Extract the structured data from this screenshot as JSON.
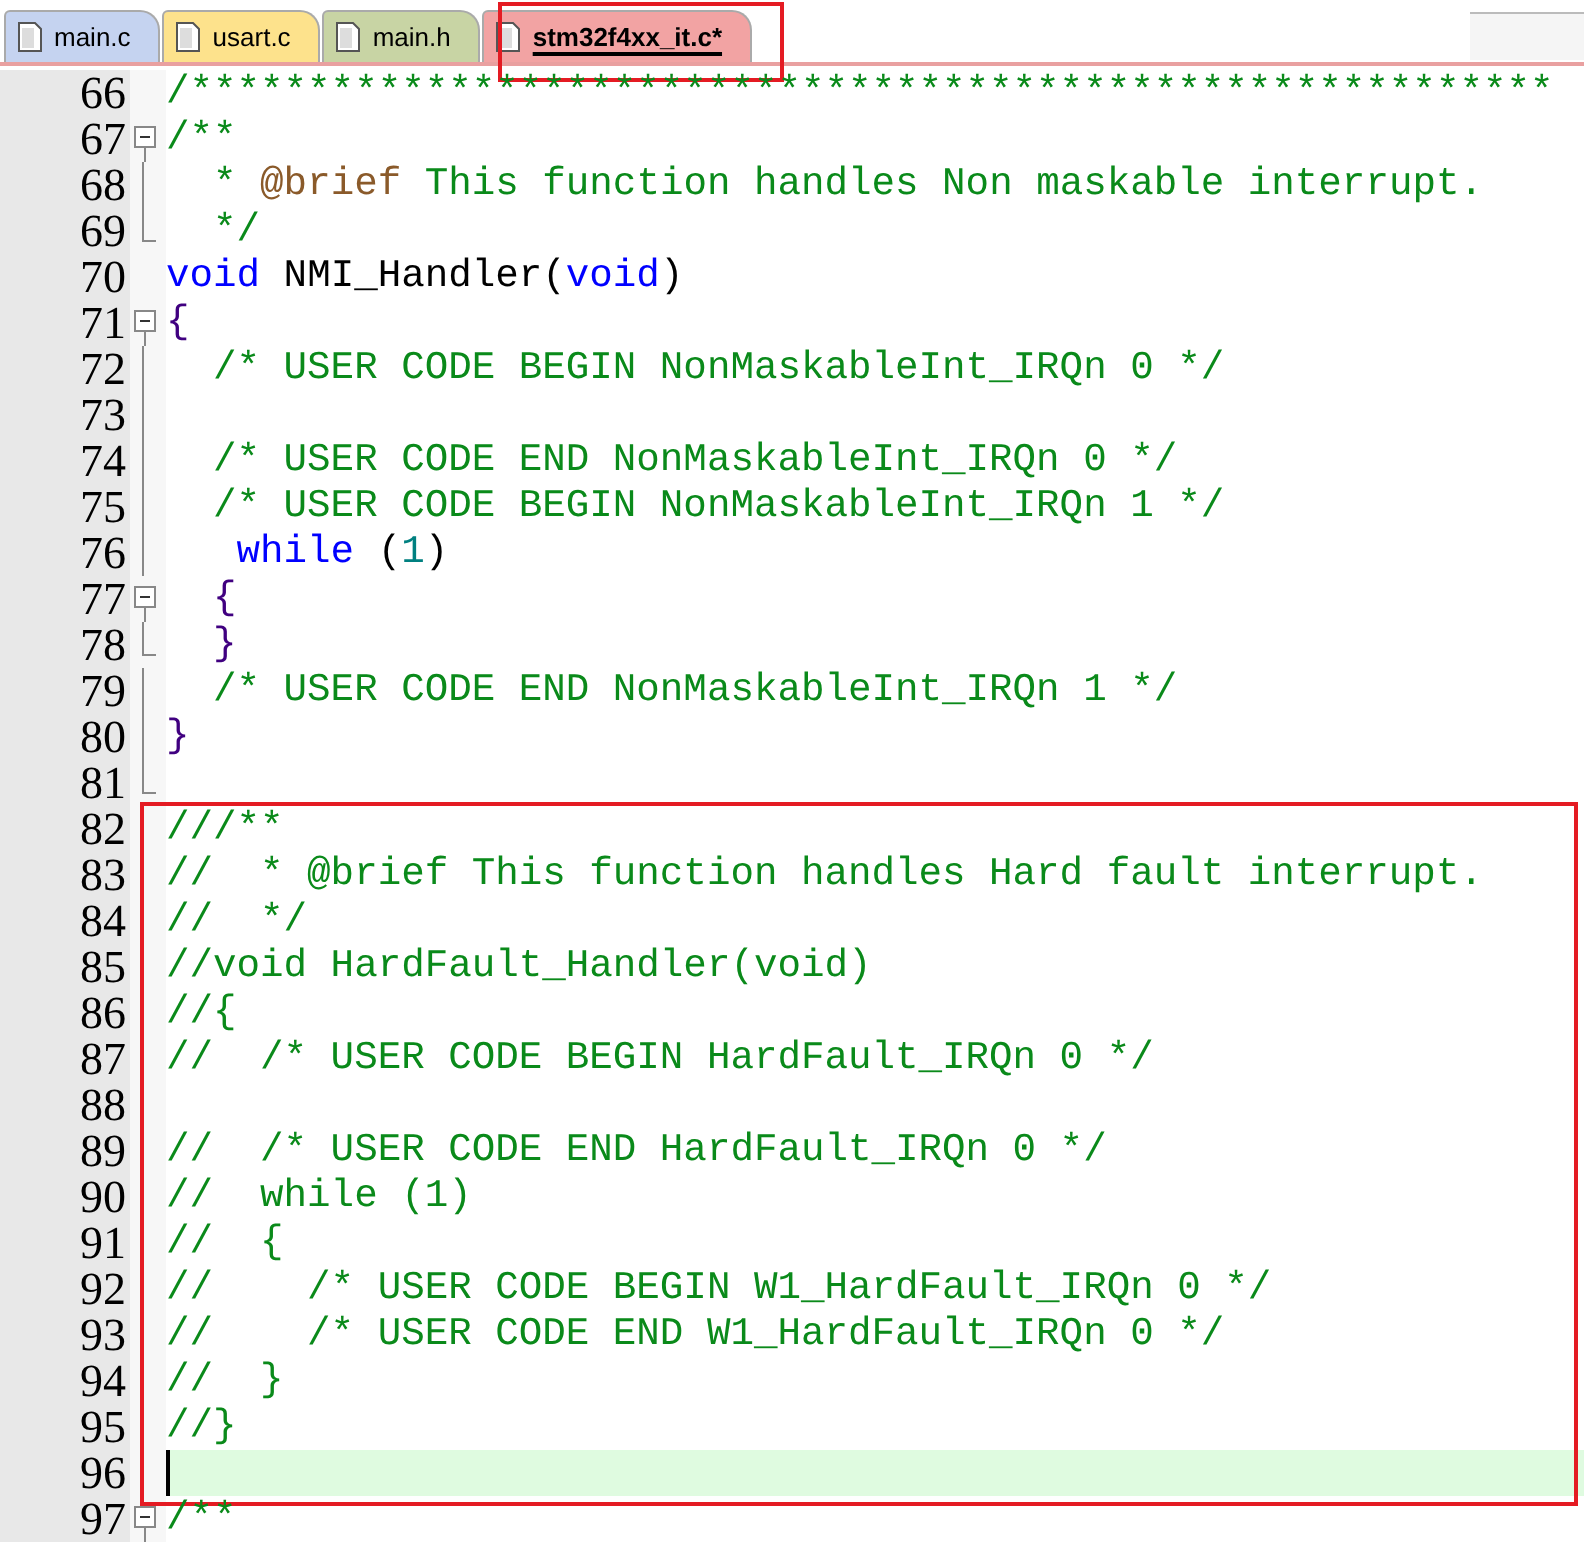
{
  "tabs": [
    {
      "label": "main.c",
      "color": "#c5d3f0",
      "selected": false,
      "highlighted": false
    },
    {
      "label": "usart.c",
      "color": "#fde28c",
      "selected": false,
      "highlighted": false
    },
    {
      "label": "main.h",
      "color": "#c8d4a4",
      "selected": false,
      "highlighted": false
    },
    {
      "label": "stm32f4xx_it.c*",
      "color": "#f2a3a3",
      "selected": true,
      "highlighted": true
    }
  ],
  "blocks": [
    {
      "boxed": false,
      "lines": [
        {
          "number": "66",
          "kind": "plain",
          "current": false,
          "segments": [
            {
              "kind": "comment",
              "text": "/**********************************************************"
            }
          ]
        },
        {
          "number": "67",
          "kind": "foldstart",
          "current": false,
          "segments": [
            {
              "kind": "comment",
              "text": "/**"
            }
          ]
        },
        {
          "number": "68",
          "kind": "foldbody",
          "current": false,
          "segments": [
            {
              "kind": "comment",
              "text": "  * "
            },
            {
              "kind": "doc",
              "text": "@brief"
            },
            {
              "kind": "comment",
              "text": " This function handles Non maskable interrupt."
            }
          ]
        },
        {
          "number": "69",
          "kind": "foldend",
          "current": false,
          "segments": [
            {
              "kind": "comment",
              "text": "  */"
            }
          ]
        },
        {
          "number": "70",
          "kind": "plain",
          "current": false,
          "segments": [
            {
              "kind": "keyword",
              "text": "void"
            },
            {
              "kind": "plain",
              "text": " NMI_Handler("
            },
            {
              "kind": "keyword",
              "text": "void"
            },
            {
              "kind": "plain",
              "text": ")"
            }
          ]
        },
        {
          "number": "71",
          "kind": "foldstart",
          "current": false,
          "segments": [
            {
              "kind": "brace",
              "text": "{"
            }
          ]
        },
        {
          "number": "72",
          "kind": "foldbody",
          "current": false,
          "segments": [
            {
              "kind": "comment",
              "text": "  /* USER CODE BEGIN NonMaskableInt_IRQn 0 */"
            }
          ]
        },
        {
          "number": "73",
          "kind": "foldbody",
          "current": false
        },
        {
          "number": "74",
          "kind": "foldbody",
          "current": false,
          "segments": [
            {
              "kind": "comment",
              "text": "  /* USER CODE END NonMaskableInt_IRQn 0 */"
            }
          ]
        },
        {
          "number": "75",
          "kind": "foldbody",
          "current": false,
          "segments": [
            {
              "kind": "comment",
              "text": "  /* USER CODE BEGIN NonMaskableInt_IRQn 1 */"
            }
          ]
        },
        {
          "number": "76",
          "kind": "foldbody",
          "current": false,
          "segments": [
            {
              "kind": "keyword",
              "text": "   while"
            },
            {
              "kind": "plain",
              "text": " ("
            },
            {
              "kind": "number",
              "text": "1"
            },
            {
              "kind": "plain",
              "text": ")"
            }
          ]
        },
        {
          "number": "77",
          "kind": "foldstart",
          "current": false,
          "segments": [
            {
              "kind": "brace",
              "text": "  {"
            }
          ]
        },
        {
          "number": "78",
          "kind": "foldend",
          "current": false,
          "segments": [
            {
              "kind": "brace",
              "text": "  }"
            }
          ]
        },
        {
          "number": "79",
          "kind": "foldbody",
          "current": false,
          "segments": [
            {
              "kind": "comment",
              "text": "  /* USER CODE END NonMaskableInt_IRQn 1 */"
            }
          ]
        },
        {
          "number": "80",
          "kind": "foldbody",
          "current": false,
          "segments": [
            {
              "kind": "brace",
              "text": "}"
            }
          ]
        },
        {
          "number": "81",
          "kind": "foldend",
          "current": false
        }
      ]
    },
    {
      "boxed": true,
      "lines": [
        {
          "number": "82",
          "kind": "plain",
          "current": false,
          "segments": [
            {
              "kind": "comment",
              "text": "///**"
            }
          ]
        },
        {
          "number": "83",
          "kind": "plain",
          "current": false,
          "segments": [
            {
              "kind": "comment",
              "text": "//  * @brief This function handles Hard fault interrupt."
            }
          ]
        },
        {
          "number": "84",
          "kind": "plain",
          "current": false,
          "segments": [
            {
              "kind": "comment",
              "text": "//  */"
            }
          ]
        },
        {
          "number": "85",
          "kind": "plain",
          "current": false,
          "segments": [
            {
              "kind": "comment",
              "text": "//void HardFault_Handler(void)"
            }
          ]
        },
        {
          "number": "86",
          "kind": "plain",
          "current": false,
          "segments": [
            {
              "kind": "comment",
              "text": "//{"
            }
          ]
        },
        {
          "number": "87",
          "kind": "plain",
          "current": false,
          "segments": [
            {
              "kind": "comment",
              "text": "//  /* USER CODE BEGIN HardFault_IRQn 0 */"
            }
          ]
        },
        {
          "number": "88",
          "kind": "plain",
          "current": false
        },
        {
          "number": "89",
          "kind": "plain",
          "current": false,
          "segments": [
            {
              "kind": "comment",
              "text": "//  /* USER CODE END HardFault_IRQn 0 */"
            }
          ]
        },
        {
          "number": "90",
          "kind": "plain",
          "current": false,
          "segments": [
            {
              "kind": "comment",
              "text": "//  while (1)"
            }
          ]
        },
        {
          "number": "91",
          "kind": "plain",
          "current": false,
          "segments": [
            {
              "kind": "comment",
              "text": "//  {"
            }
          ]
        },
        {
          "number": "92",
          "kind": "plain",
          "current": false,
          "segments": [
            {
              "kind": "comment",
              "text": "//    /* USER CODE BEGIN W1_HardFault_IRQn 0 */"
            }
          ]
        },
        {
          "number": "93",
          "kind": "plain",
          "current": false,
          "segments": [
            {
              "kind": "comment",
              "text": "//    /* USER CODE END W1_HardFault_IRQn 0 */"
            }
          ]
        },
        {
          "number": "94",
          "kind": "plain",
          "current": false,
          "segments": [
            {
              "kind": "comment",
              "text": "//  }"
            }
          ]
        },
        {
          "number": "95",
          "kind": "plain",
          "current": false,
          "segments": [
            {
              "kind": "comment",
              "text": "//}"
            }
          ]
        },
        {
          "number": "96",
          "kind": "plain",
          "current": true
        }
      ]
    },
    {
      "boxed": false,
      "lines": [
        {
          "number": "97",
          "kind": "foldstart",
          "current": false,
          "segments": [
            {
              "kind": "comment",
              "text": "/**"
            }
          ]
        }
      ]
    }
  ]
}
